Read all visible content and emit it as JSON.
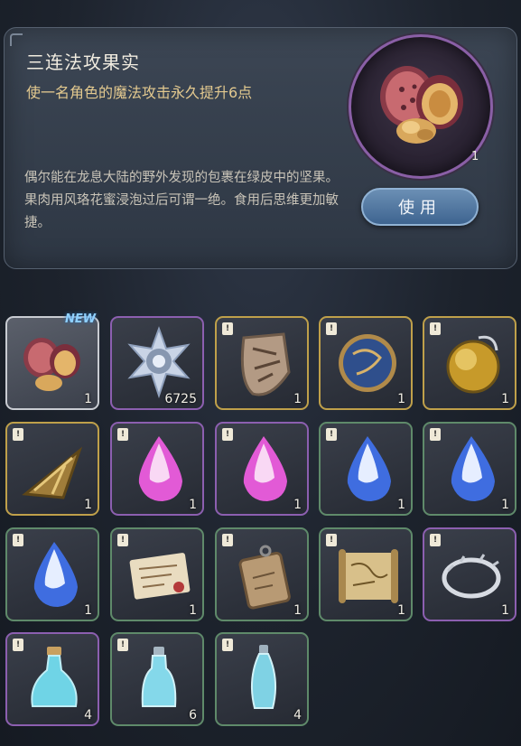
{
  "detail": {
    "title": "三连法攻果实",
    "effect": "使一名角色的魔法攻击永久提升6点",
    "description": "偶尔能在龙息大陆的野外发现的包裹在绿皮中的坚果。果肉用风珞花蜜浸泡过后可谓一绝。食用后思维更加敏捷。",
    "owned_count": "1",
    "use_button": "使用",
    "icon": "walnut-icon"
  },
  "inventory": [
    {
      "name": "walnut",
      "qty": "1",
      "badge": "NEW",
      "frame": "white",
      "icon": "walnut-icon"
    },
    {
      "name": "star-crystal",
      "qty": "6725",
      "frame": "purple",
      "icon": "star-crystal-icon"
    },
    {
      "name": "shield-emblem",
      "qty": "1",
      "frame": "gold",
      "icon": "shield-icon"
    },
    {
      "name": "blue-medallion",
      "qty": "1",
      "frame": "gold",
      "icon": "medallion-icon"
    },
    {
      "name": "amber-orb",
      "qty": "1",
      "frame": "gold",
      "icon": "orb-icon"
    },
    {
      "name": "golden-arrowhead",
      "qty": "1",
      "frame": "gold",
      "icon": "arrowhead-icon"
    },
    {
      "name": "pink-gem",
      "qty": "1",
      "frame": "purple",
      "icon": "pink-gem-icon"
    },
    {
      "name": "pink-gem",
      "qty": "1",
      "frame": "purple",
      "icon": "pink-gem-icon"
    },
    {
      "name": "blue-gem",
      "qty": "1",
      "frame": "green",
      "icon": "blue-gem-icon"
    },
    {
      "name": "blue-gem",
      "qty": "1",
      "frame": "green",
      "icon": "blue-gem-icon"
    },
    {
      "name": "blue-gem",
      "qty": "1",
      "frame": "green",
      "icon": "blue-gem-icon"
    },
    {
      "name": "letter-card",
      "qty": "1",
      "frame": "green",
      "icon": "letter-icon"
    },
    {
      "name": "wooden-tag",
      "qty": "1",
      "frame": "green",
      "icon": "tag-icon"
    },
    {
      "name": "map-scroll",
      "qty": "1",
      "frame": "green",
      "icon": "scroll-icon"
    },
    {
      "name": "silver-ring",
      "qty": "1",
      "frame": "purple",
      "icon": "ring-icon"
    },
    {
      "name": "potion-flask",
      "qty": "4",
      "frame": "purple",
      "icon": "flask-icon"
    },
    {
      "name": "potion-bottle",
      "qty": "6",
      "frame": "green",
      "icon": "bottle-icon"
    },
    {
      "name": "potion-vial",
      "qty": "4",
      "frame": "green",
      "icon": "vial-icon"
    }
  ]
}
